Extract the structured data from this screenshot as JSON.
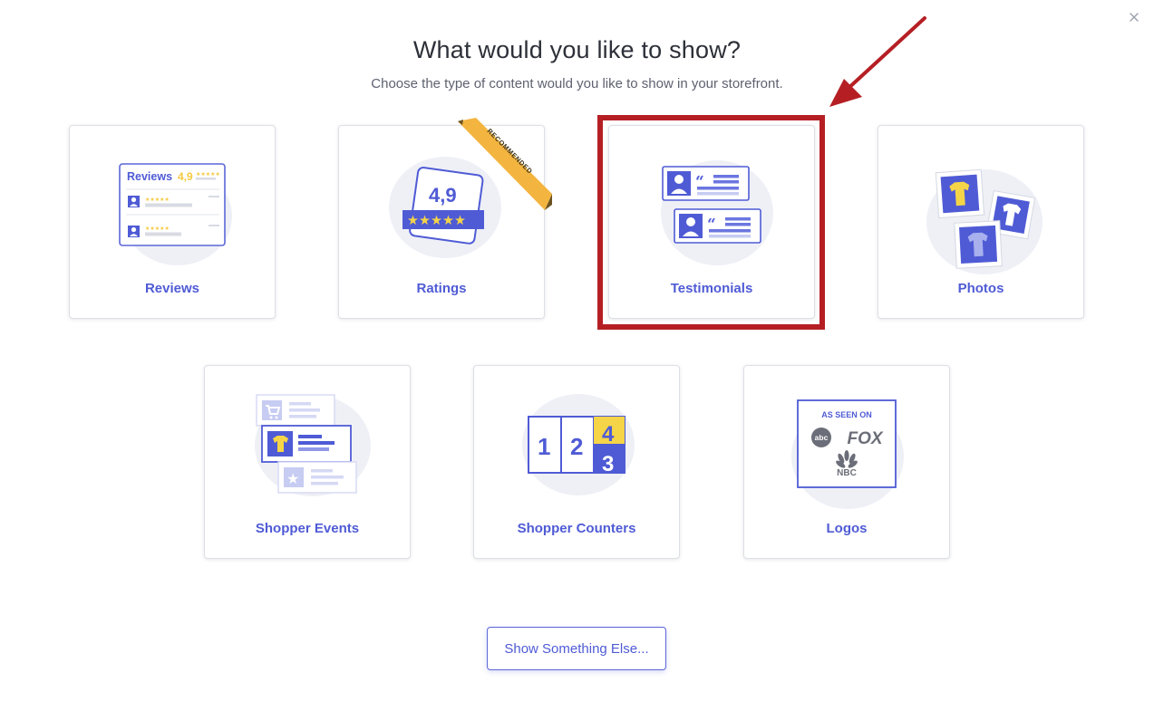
{
  "modal": {
    "title": "What would you like to show?",
    "subtitle": "Choose the type of content would you like to show in your storefront.",
    "close_icon": "close-icon"
  },
  "cards": [
    {
      "label": "Reviews",
      "icon": "reviews-illustration"
    },
    {
      "label": "Ratings",
      "icon": "ratings-illustration",
      "badge": "RECOMMENDED"
    },
    {
      "label": "Testimonials",
      "icon": "testimonials-illustration",
      "highlighted": true
    },
    {
      "label": "Photos",
      "icon": "photos-illustration"
    },
    {
      "label": "Shopper Events",
      "icon": "shopper-events-illustration"
    },
    {
      "label": "Shopper Counters",
      "icon": "shopper-counters-illustration"
    },
    {
      "label": "Logos",
      "icon": "logos-illustration"
    }
  ],
  "illustrations": {
    "reviews_heading": "Reviews",
    "reviews_score": "4,9",
    "ratings_score": "4,9",
    "counter_digits": [
      "1",
      "2",
      "4",
      "3"
    ],
    "logos_heading": "AS SEEN ON",
    "logo_abc": "abc",
    "logo_fox": "FOX",
    "logo_nbc": "NBC"
  },
  "footer": {
    "button_label": "Show Something Else..."
  },
  "colors": {
    "accent": "#4f5bd5",
    "star_yellow": "#f5d547",
    "ribbon": "#f3b53f",
    "highlight_red": "#b51f24",
    "blob": "#eef0f6"
  }
}
